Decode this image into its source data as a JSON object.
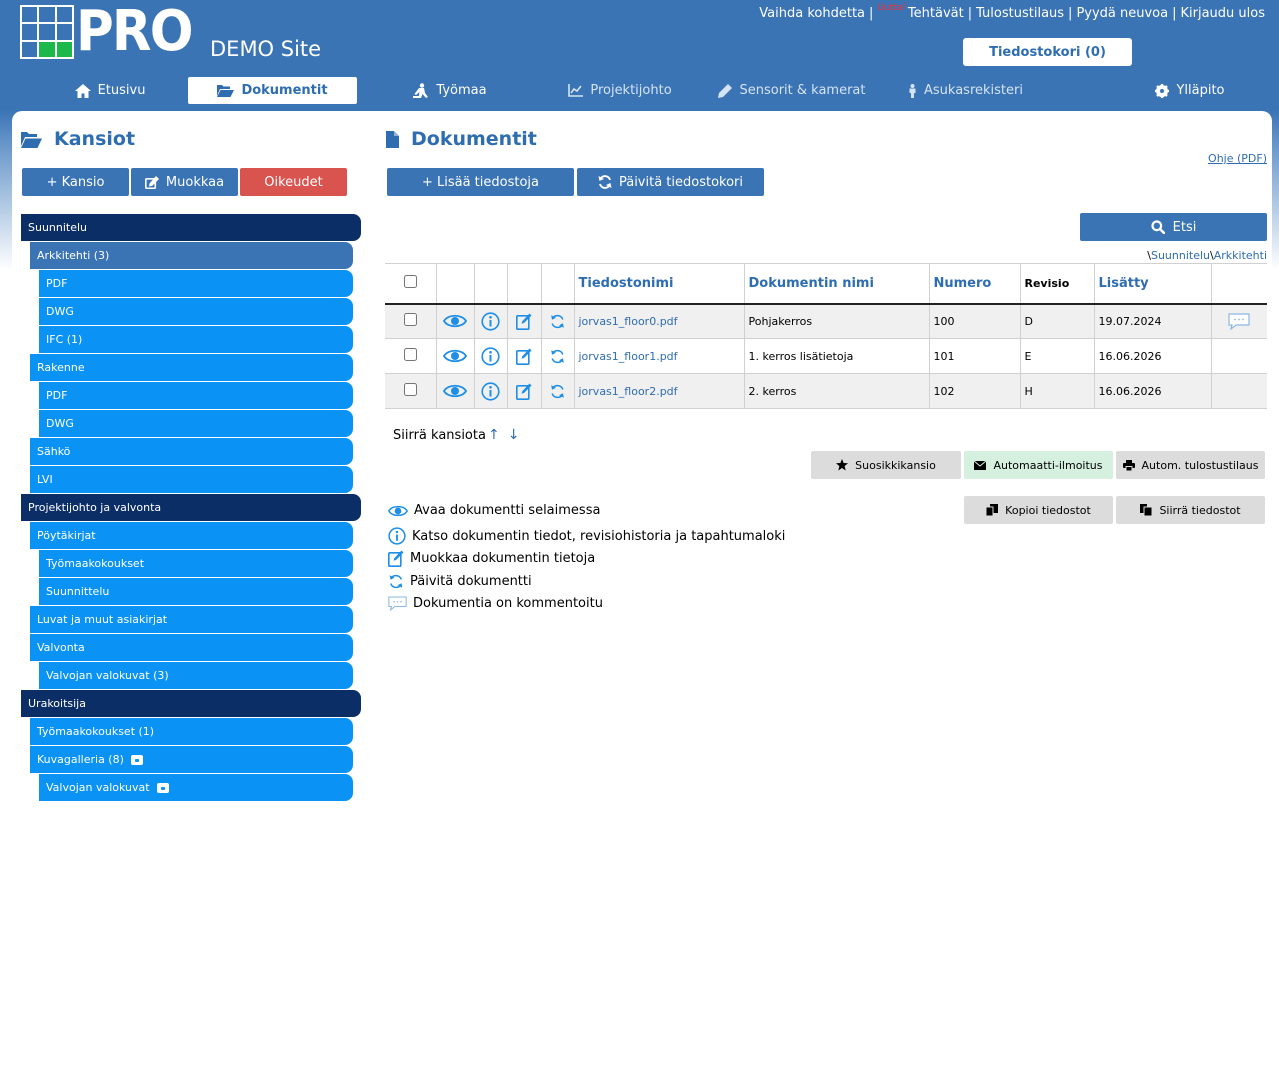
{
  "header": {
    "logo_text": "PRO",
    "site_name": "DEMO Site",
    "links": {
      "change_site": "Vaihda kohdetta",
      "new_badge": "Uutta!",
      "tasks": "Tehtävät",
      "print_order": "Tulostustilaus",
      "ask_help": "Pyydä neuvoa",
      "logout": "Kirjaudu ulos"
    },
    "file_cart": "Tiedostokori (0)"
  },
  "nav": {
    "home": "Etusivu",
    "documents": "Dokumentit",
    "worksite": "Työmaa",
    "project_mgmt": "Projektijohto",
    "sensors": "Sensorit & kamerat",
    "residents": "Asukasrekisteri",
    "admin": "Ylläpito"
  },
  "folders_panel": {
    "title": "Kansiot",
    "add_folder": "+ Kansio",
    "edit": "Muokkaa",
    "rights": "Oikeudet",
    "tree": [
      "Suunnitelu",
      "Arkkitehti (3)",
      "PDF",
      "DWG",
      "IFC (1)",
      "Rakenne",
      "PDF",
      "DWG",
      "Sähkö",
      "LVI",
      "Projektijohto ja valvonta",
      "Pöytäkirjat",
      "Työmaakokoukset",
      "Suunnittelu",
      "Luvat ja muut asiakirjat",
      "Valvonta",
      "Valvojan valokuvat (3)",
      "Urakoitsija",
      "Työmaakokoukset (1)",
      "Kuvagalleria (8)",
      "Valvojan valokuvat"
    ]
  },
  "documents_panel": {
    "title": "Dokumentit",
    "help_link": "Ohje (PDF)",
    "add_files": "+ Lisää tiedostoja",
    "refresh_cart": "Päivitä tiedostokori",
    "search": "Etsi",
    "breadcrumb": [
      "Suunnitelu",
      "Arkkitehti"
    ],
    "columns": {
      "filename": "Tiedostonimi",
      "docname": "Dokumentin nimi",
      "number": "Numero",
      "revision": "Revisio",
      "added": "Lisätty"
    },
    "rows": [
      {
        "filename": "jorvas1_floor0.pdf",
        "docname": "Pohjakerros",
        "number": "100",
        "revision": "D",
        "added": "19.07.2024"
      },
      {
        "filename": "jorvas1_floor1.pdf",
        "docname": "1. kerros lisätietoja",
        "number": "101",
        "revision": "E",
        "added": "16.06.2026"
      },
      {
        "filename": "jorvas1_floor2.pdf",
        "docname": "2. kerros",
        "number": "102",
        "revision": "H",
        "added": "16.06.2026"
      }
    ],
    "move_folder": "Siirrä kansiota",
    "move_up": "↑",
    "move_down": "↓",
    "favorite_folder": "Suosikkikansio",
    "auto_notify": "Automaatti-ilmoitus",
    "auto_print": "Autom. tulostustilaus",
    "copy_files": "Kopioi tiedostot",
    "move_files": "Siirrä tiedostot",
    "legend": {
      "open": "Avaa dokumentti selaimessa",
      "info": "Katso dokumentin tiedot, revisiohistoria ja tapahtumaloki",
      "edit": "Muokkaa dokumentin tietoja",
      "update": "Päivitä dokumentti",
      "commented": "Dokumentia on kommentoitu"
    }
  },
  "colors": {
    "header_blue": "#3a74b5",
    "accent_text": "#2f6db1",
    "tree_light": "#0a93f5",
    "tree_root": "#0c2e66",
    "danger": "#d9534f"
  }
}
